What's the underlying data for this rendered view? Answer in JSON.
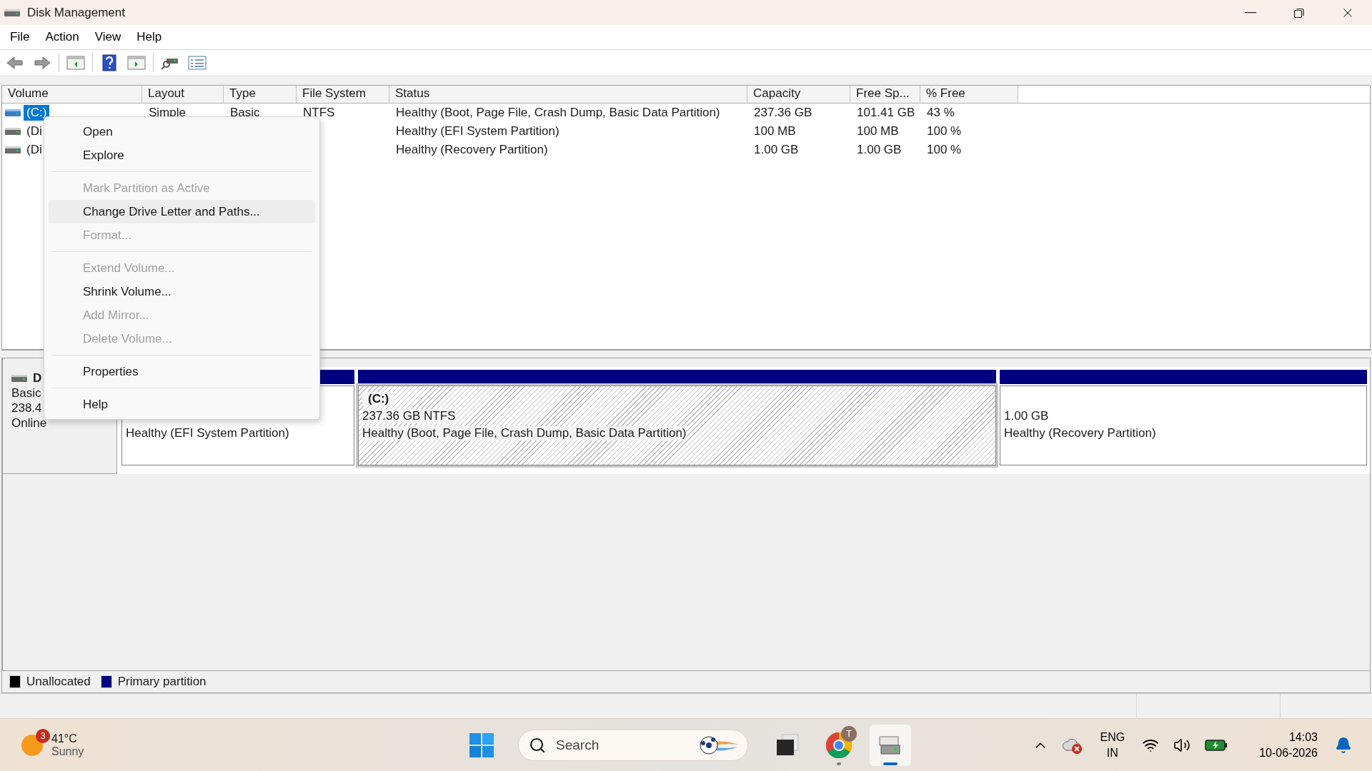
{
  "window": {
    "title": "Disk Management"
  },
  "menu_bar": [
    {
      "label": "File"
    },
    {
      "label": "Action"
    },
    {
      "label": "View"
    },
    {
      "label": "Help"
    }
  ],
  "volume_table": {
    "columns": [
      "Volume",
      "Layout",
      "Type",
      "File System",
      "Status",
      "Capacity",
      "Free Sp...",
      "% Free"
    ],
    "rows": [
      {
        "volume": "(C:)",
        "layout": "Simple",
        "type": "Basic",
        "file_system": "NTFS",
        "status": "Healthy (Boot, Page File, Crash Dump, Basic Data Partition)",
        "capacity": "237.36 GB",
        "free_space": "101.41 GB",
        "percent_free": "43 %",
        "selected": true
      },
      {
        "volume": "(Di",
        "status": "Healthy (EFI System Partition)",
        "capacity": "100 MB",
        "free_space": "100 MB",
        "percent_free": "100 %",
        "selected": false
      },
      {
        "volume": "(Di",
        "status": "Healthy (Recovery Partition)",
        "capacity": "1.00 GB",
        "free_space": "1.00 GB",
        "percent_free": "100 %",
        "selected": false
      }
    ]
  },
  "context_menu": {
    "items": [
      {
        "kind": "item",
        "label": "Open",
        "disabled": false,
        "selected": false
      },
      {
        "kind": "item",
        "label": "Explore",
        "disabled": false,
        "selected": false
      },
      {
        "kind": "separator"
      },
      {
        "kind": "item",
        "label": "Mark Partition as Active",
        "disabled": true,
        "selected": false
      },
      {
        "kind": "item",
        "label": "Change Drive Letter and Paths...",
        "disabled": false,
        "selected": true
      },
      {
        "kind": "item",
        "label": "Format...",
        "disabled": true,
        "selected": false
      },
      {
        "kind": "separator"
      },
      {
        "kind": "item",
        "label": "Extend Volume...",
        "disabled": true,
        "selected": false
      },
      {
        "kind": "item",
        "label": "Shrink Volume...",
        "disabled": false,
        "selected": false
      },
      {
        "kind": "item",
        "label": "Add Mirror...",
        "disabled": true,
        "selected": false
      },
      {
        "kind": "item",
        "label": "Delete Volume...",
        "disabled": true,
        "selected": false
      },
      {
        "kind": "separator"
      },
      {
        "kind": "item",
        "label": "Properties",
        "disabled": false,
        "selected": false
      },
      {
        "kind": "separator"
      },
      {
        "kind": "item",
        "label": "Help",
        "disabled": false,
        "selected": false
      }
    ]
  },
  "disk": {
    "name": "D",
    "type": "Basic",
    "size": "238.4",
    "status": "Online",
    "partitions": [
      {
        "status": "Healthy (EFI System Partition)",
        "selected": false
      },
      {
        "label": "(C:)",
        "size": "237.36 GB NTFS",
        "status": "Healthy (Boot, Page File, Crash Dump, Basic Data Partition)",
        "selected": true
      },
      {
        "size": "1.00 GB",
        "status": "Healthy (Recovery Partition)",
        "selected": false
      }
    ]
  },
  "legend": [
    {
      "label": "Unallocated",
      "color": "#000000"
    },
    {
      "label": "Primary partition",
      "color": "#000080"
    }
  ],
  "taskbar": {
    "weather": {
      "badge": "3",
      "temperature": "41°C",
      "condition": "Sunny"
    },
    "search": {
      "placeholder": "Search"
    },
    "apps": [
      {
        "kind": "files",
        "running": false,
        "selected": false
      },
      {
        "kind": "browser",
        "badge": "T",
        "running": true,
        "selected": false
      },
      {
        "kind": "disk",
        "running": true,
        "selected": true
      }
    ],
    "tray": {
      "language": "ENG",
      "region": "IN",
      "time": "14:03",
      "date": "10-06-2026"
    }
  }
}
